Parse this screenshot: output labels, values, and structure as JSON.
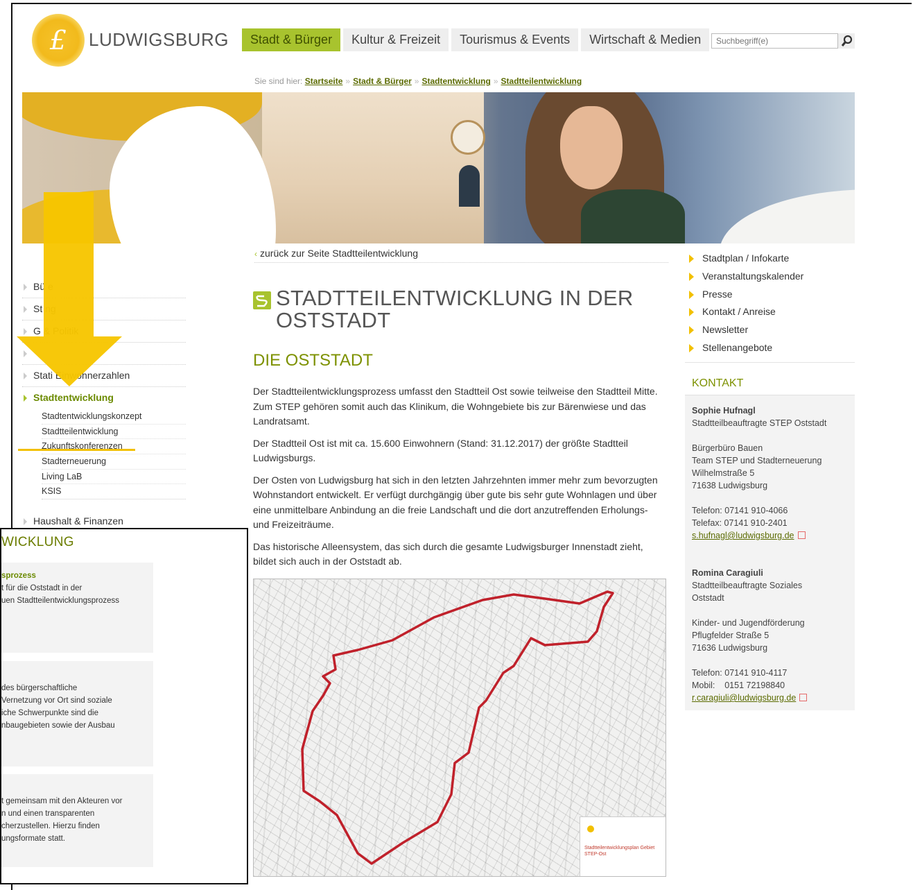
{
  "header": {
    "logo_text": "LUDWIGSBURG",
    "logo_glyph": "£",
    "nav": [
      "Stadt & Bürger",
      "Kultur & Freizeit",
      "Tourismus & Events",
      "Wirtschaft & Medien"
    ],
    "search_placeholder": "Suchbegriff(e)"
  },
  "breadcrumb": {
    "prefix": "Sie sind hier:",
    "items": [
      "Startseite",
      "Stadt & Bürger",
      "Stadtentwicklung",
      "Stadtteilentwicklung"
    ],
    "separator": "»"
  },
  "leftnav": {
    "items": [
      "Bü               e",
      "St                  ng",
      "G                   & Politik",
      "",
      "Stati          Einwohnerzahlen"
    ],
    "active": "Stadtentwicklung",
    "sub": [
      "Stadtentwicklungskonzept",
      "Stadtteilentwicklung",
      "Zukunftskonferenzen",
      "Stadterneuerung",
      "Living LaB",
      "KSIS"
    ],
    "after": "Haushalt & Finanzen"
  },
  "main": {
    "back_link": "zurück zur Seite Stadtteilentwicklung",
    "title": "STADTTEILENTWICKLUNG IN DER OSTSTADT",
    "section": "DIE OSTSTADT",
    "paragraphs": [
      "Der Stadtteilentwicklungsprozess umfasst den Stadtteil Ost sowie teilweise den Stadtteil Mitte. Zum STEP gehören somit auch das Klinikum, die Wohngebiete bis zur Bärenwiese und das Landratsamt.",
      "Der Stadtteil Ost ist mit ca. 15.600 Einwohnern (Stand: 31.12.2017) der größte Stadtteil Ludwigsburgs.",
      "Der Osten von Ludwigsburg hat sich in den letzten Jahrzehnten immer mehr zum bevorzugten Wohnstandort entwickelt. Er verfügt durchgängig über gute bis sehr gute Wohnlagen und über eine unmittelbare Anbindung an die freie Landschaft und die dort anzutreffenden Erholungs- und Freizeiträume.",
      "Das historische Alleensystem, das sich durch die gesamte Ludwigsburger Innenstadt zieht, bildet sich auch in der Oststadt ab."
    ],
    "map_card_caption": "Stadtteilentwicklungsplan Gebiet STEP-Ost"
  },
  "quicklinks": [
    "Stadtplan / Infokarte",
    "Veranstaltungskalender",
    "Presse",
    "Kontakt / Anreise",
    "Newsletter",
    "Stellenangebote"
  ],
  "kontakt": {
    "heading": "KONTAKT",
    "p1_name": "Sophie Hufnagl",
    "p1_role": "Stadtteilbeauftragte STEP Oststadt",
    "p1_org1": "Bürgerbüro Bauen",
    "p1_org2": "Team STEP und Stadterneuerung",
    "p1_street": "Wilhelmstraße 5",
    "p1_city": "71638 Ludwigsburg",
    "p1_phone": "Telefon: 07141 910-4066",
    "p1_fax": "Telefax: 07141 910-2401",
    "p1_email": "s.hufnagl@ludwigsburg.de",
    "p2_name": "Romina Caragiuli",
    "p2_role1": "Stadtteilbeauftragte Soziales",
    "p2_role2": "Oststadt",
    "p2_org": "Kinder- und Jugendförderung",
    "p2_street": "Pflugfelder Straße 5",
    "p2_city": "71636 Ludwigsburg",
    "p2_phone": "Telefon: 07141 910-4117",
    "p2_mobile": "Mobil:    0151 72198840",
    "p2_email": "r.caragiuli@ludwigsburg.de"
  },
  "inset": {
    "title": "WICKLUNG",
    "card1": [
      "sprozess",
      "t für die Oststadt in der",
      "uen Stadtteilentwicklungsprozess"
    ],
    "card2": [
      "des bürgerschaftliche",
      "Vernetzung vor Ort sind soziale",
      "iche Schwerpunkte sind die",
      "nbaugebieten sowie der Ausbau"
    ],
    "card3": [
      "t gemeinsam mit den Akteuren vor",
      "n und einen transparenten",
      "cherzustellen. Hierzu finden",
      "ungsformate statt."
    ]
  },
  "colors": {
    "accent": "#a8c32e",
    "accent_text": "#7d9100",
    "highlight": "#f2c000",
    "map_outline": "#c0212b"
  }
}
